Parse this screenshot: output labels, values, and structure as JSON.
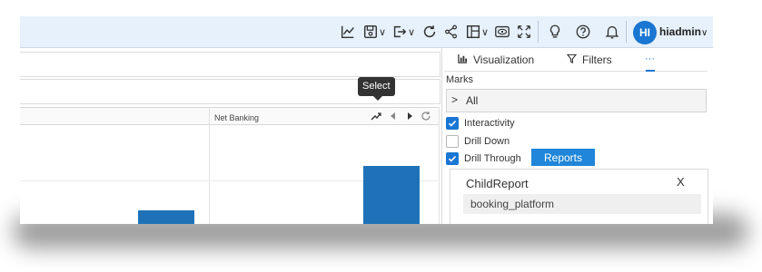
{
  "toolbar": {
    "icons": [
      "line-chart-icon",
      "save-icon",
      "export-icon",
      "refresh-icon",
      "share-icon",
      "layout-icon",
      "preview-icon",
      "fullscreen-icon",
      "lightbulb-icon",
      "help-icon",
      "bell-icon"
    ],
    "user": {
      "initials": "HI",
      "name": "hiadmin"
    }
  },
  "canvas": {
    "column_header": "Net Banking",
    "tooltip": "Select",
    "bar_color": "#1f72b8"
  },
  "panel": {
    "tabs": [
      {
        "label": "Visualization",
        "icon": "bar-chart-icon"
      },
      {
        "label": "Filters",
        "icon": "filter-icon"
      },
      {
        "label": "···",
        "icon": "more-icon"
      }
    ],
    "marks_label": "Marks",
    "marks_all": "All",
    "options": [
      {
        "label": "Interactivity",
        "checked": true
      },
      {
        "label": "Drill Down",
        "checked": false
      },
      {
        "label": "Drill Through",
        "checked": true
      }
    ],
    "reports_button": "Reports",
    "child_report": {
      "title": "ChildReport",
      "close": "X",
      "field": "booking_platform"
    },
    "accent_color": "#1976d2"
  }
}
